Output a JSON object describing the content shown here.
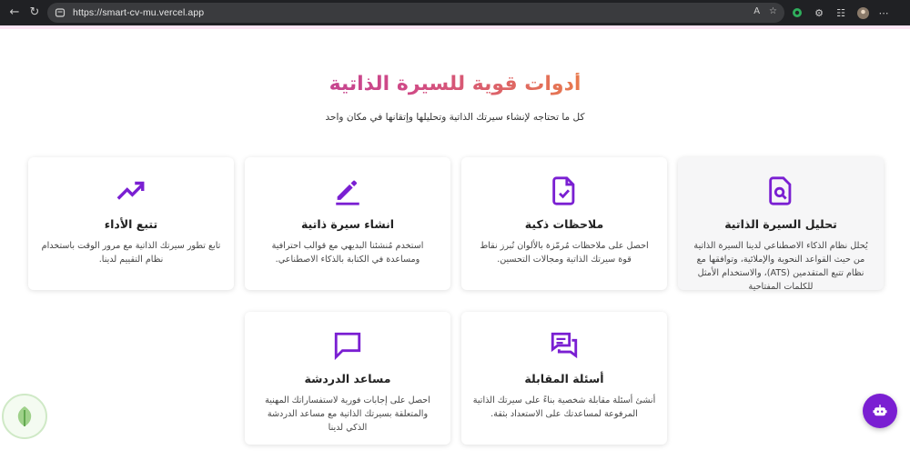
{
  "browser": {
    "url": "https://smart-cv-mu.vercel.app",
    "reader_label": "A"
  },
  "hero": {
    "title": "أدوات قوية للسيرة الذاتية",
    "subtitle": "كل ما تحتاجه لإنشاء سيرتك الذاتية وتحليلها وإتقانها في مكان واحد"
  },
  "cards": [
    {
      "title": "تحليل السيرة الذاتية",
      "description": "يُحلل نظام الذكاء الاصطناعي لدينا السيرة الذاتية من حيث القواعد النحوية والإملائية، وتوافقها مع نظام تتبع المتقدمين (ATS)، والاستخدام الأمثل للكلمات المفتاحية",
      "icon": "resume-search-icon"
    },
    {
      "title": "ملاحظات ذكية",
      "description": "احصل على ملاحظات مُرمّزة بالألوان تُبرز نقاط قوة سيرتك الذاتية ومجالات التحسين.",
      "icon": "document-check-icon"
    },
    {
      "title": "انشاء سيرة ذاتية",
      "description": "استخدم مُنشئنا البديهي مع قوالب احترافية ومساعدة في الكتابة بالذكاء الاصطناعي.",
      "icon": "pen-edit-icon"
    },
    {
      "title": "تتبع الأداء",
      "description": "تابع تطور سيرتك الذاتية مع مرور الوقت باستخدام نظام التقييم لدينا.",
      "icon": "trending-up-icon"
    },
    {
      "title": "أسئلة المقابلة",
      "description": "أنشئ أسئلة مقابلة شخصية بناءً على سيرتك الذاتية المرفوعة لمساعدتك على الاستعداد بثقة.",
      "icon": "chat-bubbles-icon"
    },
    {
      "title": "مساعد الدردشة",
      "description": "احصل على إجابات فورية لاستفساراتك المهنية والمتعلقة بسيرتك الذاتية مع مساعد الدردشة الذكي لدينا",
      "icon": "chat-bubble-icon"
    }
  ],
  "colors": {
    "accent": "#7a1fd2",
    "title_gradient": [
      "#9b2fb5",
      "#f08a3a"
    ]
  }
}
